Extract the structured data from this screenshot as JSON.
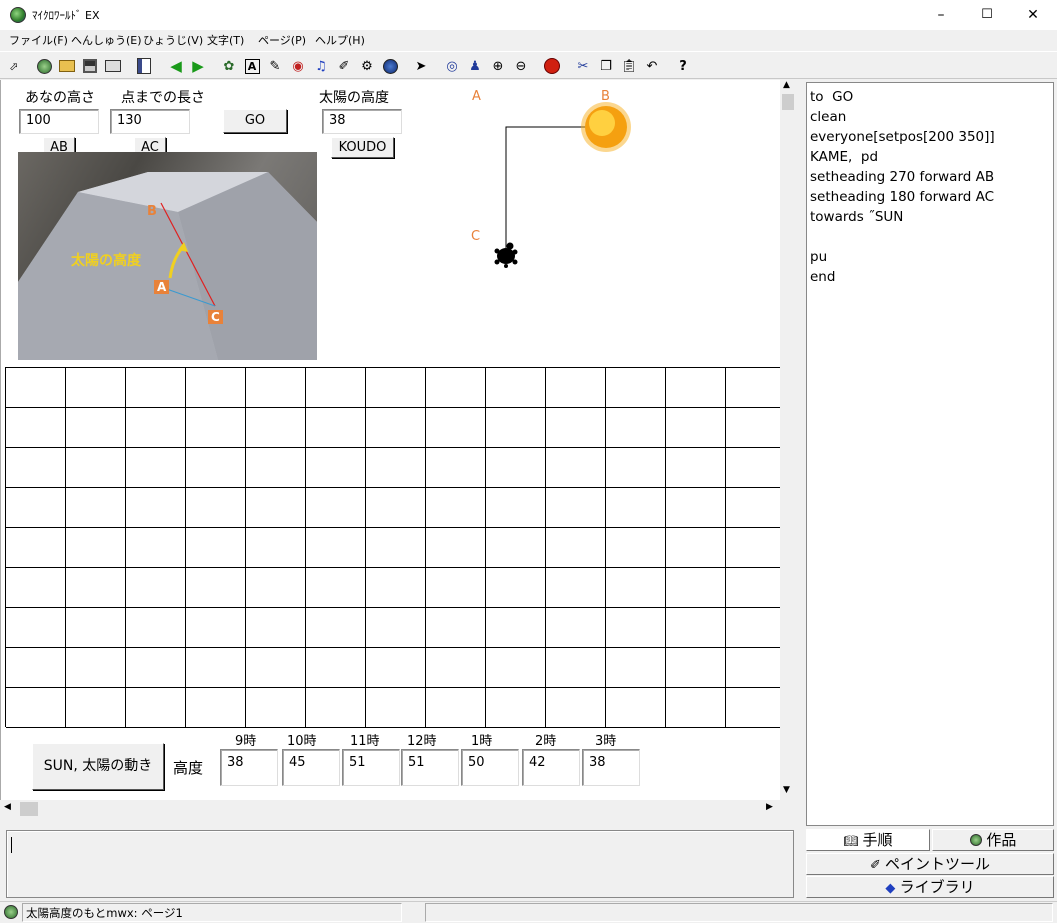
{
  "window": {
    "title": "ﾏｲｸﾛﾜｰﾙﾄﾞ EX",
    "minimize": "–",
    "maximize": "☐",
    "close": "✕"
  },
  "menu": [
    "ファイル(F)",
    "へんしゅう(E)",
    "ひょうじ(V)",
    "文字(T)",
    "ページ(P)",
    "ヘルプ(H)"
  ],
  "toolbar_icons": [
    "select-corner",
    "globe",
    "open-folder",
    "save",
    "print",
    "page",
    "back-arrow",
    "forward-arrow",
    "turtle",
    "text",
    "pen",
    "eye-shape",
    "music",
    "brush",
    "projector",
    "globe2",
    "pointer",
    "eye",
    "stamp",
    "zoom-in",
    "zoom-out",
    "stop",
    "scissors",
    "copy",
    "paste",
    "undo",
    "help"
  ],
  "inputs": {
    "hole_height": {
      "label": "あなの高さ",
      "value": "100",
      "button": "AB"
    },
    "distance": {
      "label": "点までの長さ",
      "value": "130",
      "button": "AC"
    },
    "go": {
      "button": "GO"
    },
    "sun_altitude": {
      "label": "太陽の高度",
      "value": "38",
      "button": "KOUDO"
    }
  },
  "turtle_diagram": {
    "A": "A",
    "B": "B",
    "C": "C"
  },
  "photo": {
    "B": "B",
    "A": "A",
    "C": "C",
    "caption": "太陽の高度"
  },
  "bottom": {
    "sun_button": "SUN, 太陽の動き",
    "altitude_label": "高度",
    "hours": [
      "9時",
      "10時",
      "11時",
      "12時",
      "1時",
      "2時",
      "3時"
    ],
    "values": [
      "38",
      "45",
      "51",
      "51",
      "50",
      "42",
      "38"
    ]
  },
  "code": [
    "to  GO",
    "clean",
    "everyone[setpos[200 350]]",
    "KAME,  pd",
    "setheading 270 forward AB",
    "setheading 180 forward AC",
    "towards ˝SUN",
    "",
    "pu",
    "end"
  ],
  "panel_tabs": {
    "procedure": "手順",
    "works": "作品",
    "paint": "ペイントツール",
    "library": "ライブラリ"
  },
  "status": {
    "file": "太陽高度のもとmwx:  ページ1"
  },
  "colors": {
    "accent_orange": "#e8823a",
    "red_line": "#e02020",
    "caption_yellow": "#f0d020"
  }
}
